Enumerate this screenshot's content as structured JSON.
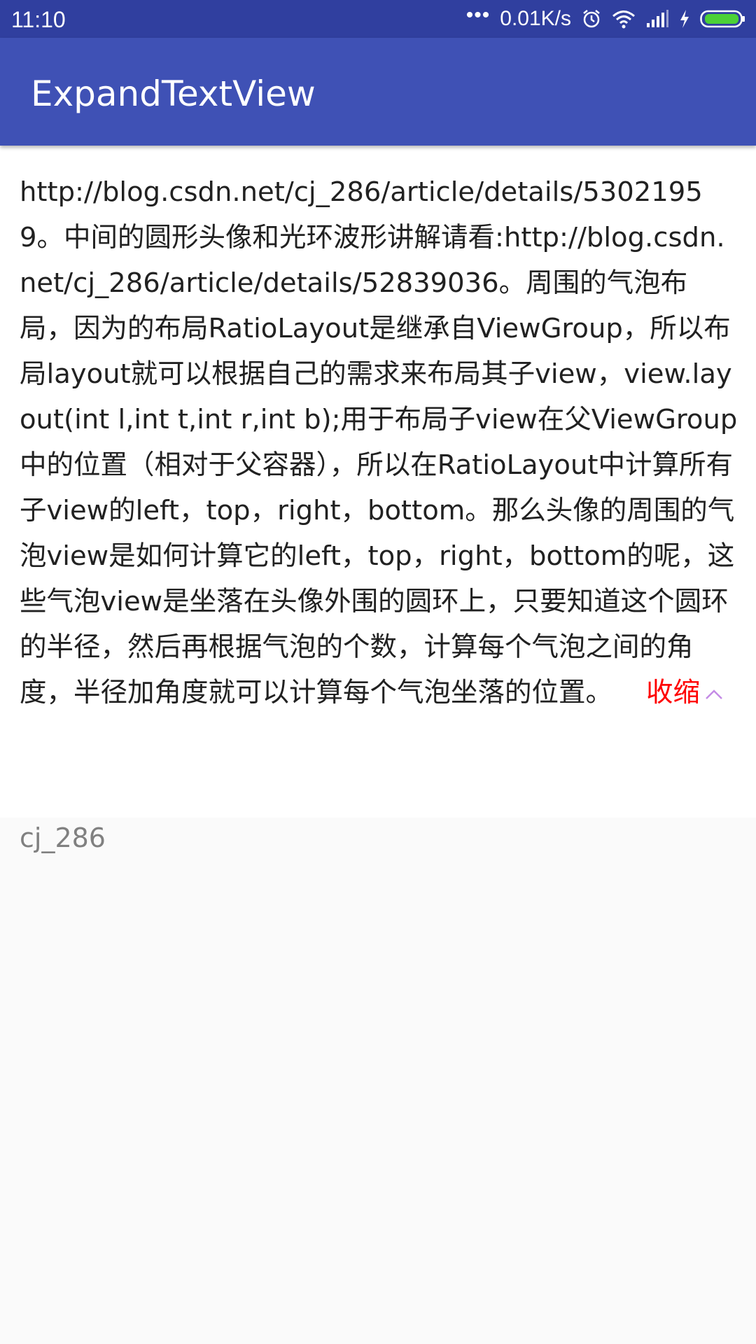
{
  "status_bar": {
    "time": "11:10",
    "dots": "•••",
    "network_speed": "0.01K/s",
    "icons": [
      "alarm-icon",
      "wifi-icon",
      "signal-icon",
      "charging-icon",
      "battery-icon"
    ],
    "battery_color": "#4cd137"
  },
  "app_bar": {
    "title": "ExpandTextView",
    "color": "#3f51b5"
  },
  "article": {
    "body": "http://blog.csdn.net/cj_286/article/details/53021959。中间的圆形头像和光环波形讲解请看:http://blog.csdn.net/cj_286/article/details/52839036。周围的气泡布局，因为的布局RatioLayout是继承自ViewGroup，所以布局layout就可以根据自己的需求来布局其子view，view.layout(int l,int t,int r,int b);用于布局子view在父ViewGroup中的位置（相对于父容器），所以在RatioLayout中计算所有子view的left，top，right，bottom。那么头像的周围的气泡view是如何计算它的left，top，right，bottom的呢，这些气泡view是坐落在头像外围的圆环上，只要知道这个圆环的半径，然后再根据气泡的个数，计算每个气泡之间的角度，半径加角度就可以计算每个气泡坐落的位置。",
    "collapse_label": "收缩",
    "collapse_color": "#ff0000",
    "collapse_icon": "chevron-up-icon"
  },
  "author": {
    "name": "cj_286"
  }
}
